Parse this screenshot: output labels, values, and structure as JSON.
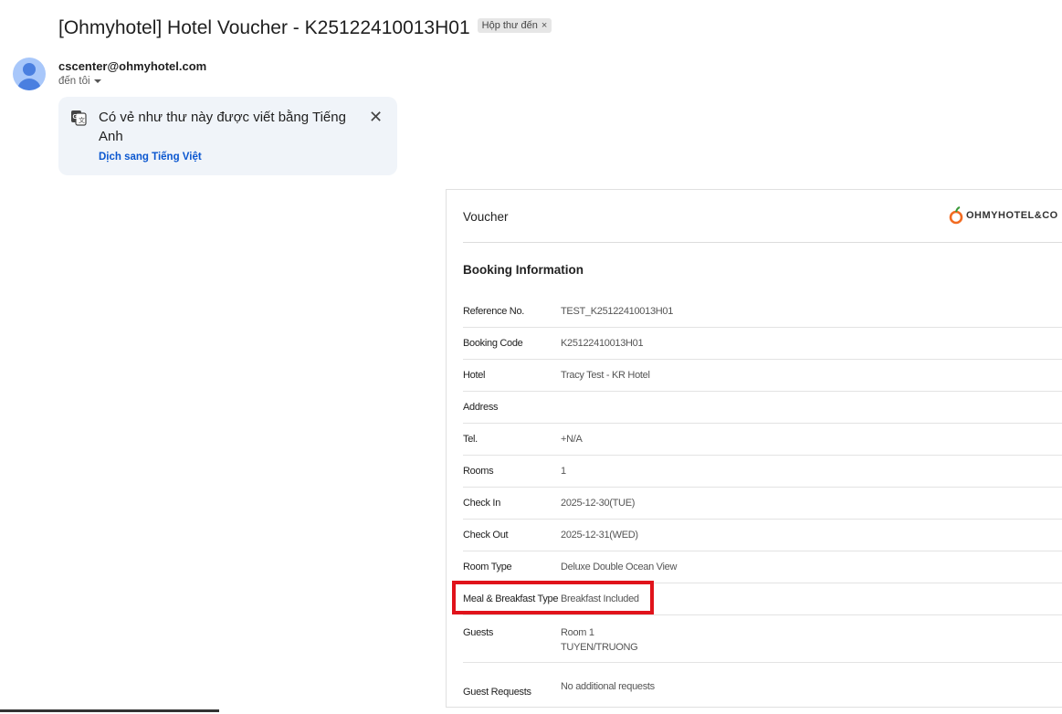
{
  "email": {
    "subject": "[Ohmyhotel] Hotel Voucher - K25122410013H01",
    "label_badge": "Hộp thư đến",
    "label_remove": "×",
    "sender": "cscenter@ohmyhotel.com",
    "recipient": "đến tôi"
  },
  "translate_banner": {
    "message": "Có vẻ như thư này được viết bằng Tiếng Anh",
    "action": "Dịch sang Tiếng Việt",
    "close": "✕"
  },
  "voucher": {
    "title": "Voucher",
    "logo_text": "OHMYHOTEL&CO",
    "section_title": "Booking Information",
    "rows": [
      {
        "label": "Reference No.",
        "value": "TEST_K25122410013H01"
      },
      {
        "label": "Booking Code",
        "value": "K25122410013H01"
      },
      {
        "label": "Hotel",
        "value": "Tracy Test - KR Hotel"
      },
      {
        "label": "Address",
        "value": ""
      },
      {
        "label": "Tel.",
        "value": "+N/A"
      },
      {
        "label": "Rooms",
        "value": "1"
      },
      {
        "label": "Check In",
        "value": "2025-12-30(TUE)"
      },
      {
        "label": "Check Out",
        "value": "2025-12-31(WED)"
      },
      {
        "label": "Room Type",
        "value": "Deluxe Double Ocean View"
      },
      {
        "label": "Meal & Breakfast Type",
        "value": "Breakfast Included"
      }
    ],
    "guests": {
      "label": "Guests",
      "room": "Room 1",
      "name": "TUYEN/TRUONG"
    },
    "requests": {
      "label": "Guest Requests",
      "value": "No additional requests"
    }
  },
  "colors": {
    "highlight": "#e0131b",
    "link": "#0b57d0",
    "logo_orange": "#f26b21"
  }
}
